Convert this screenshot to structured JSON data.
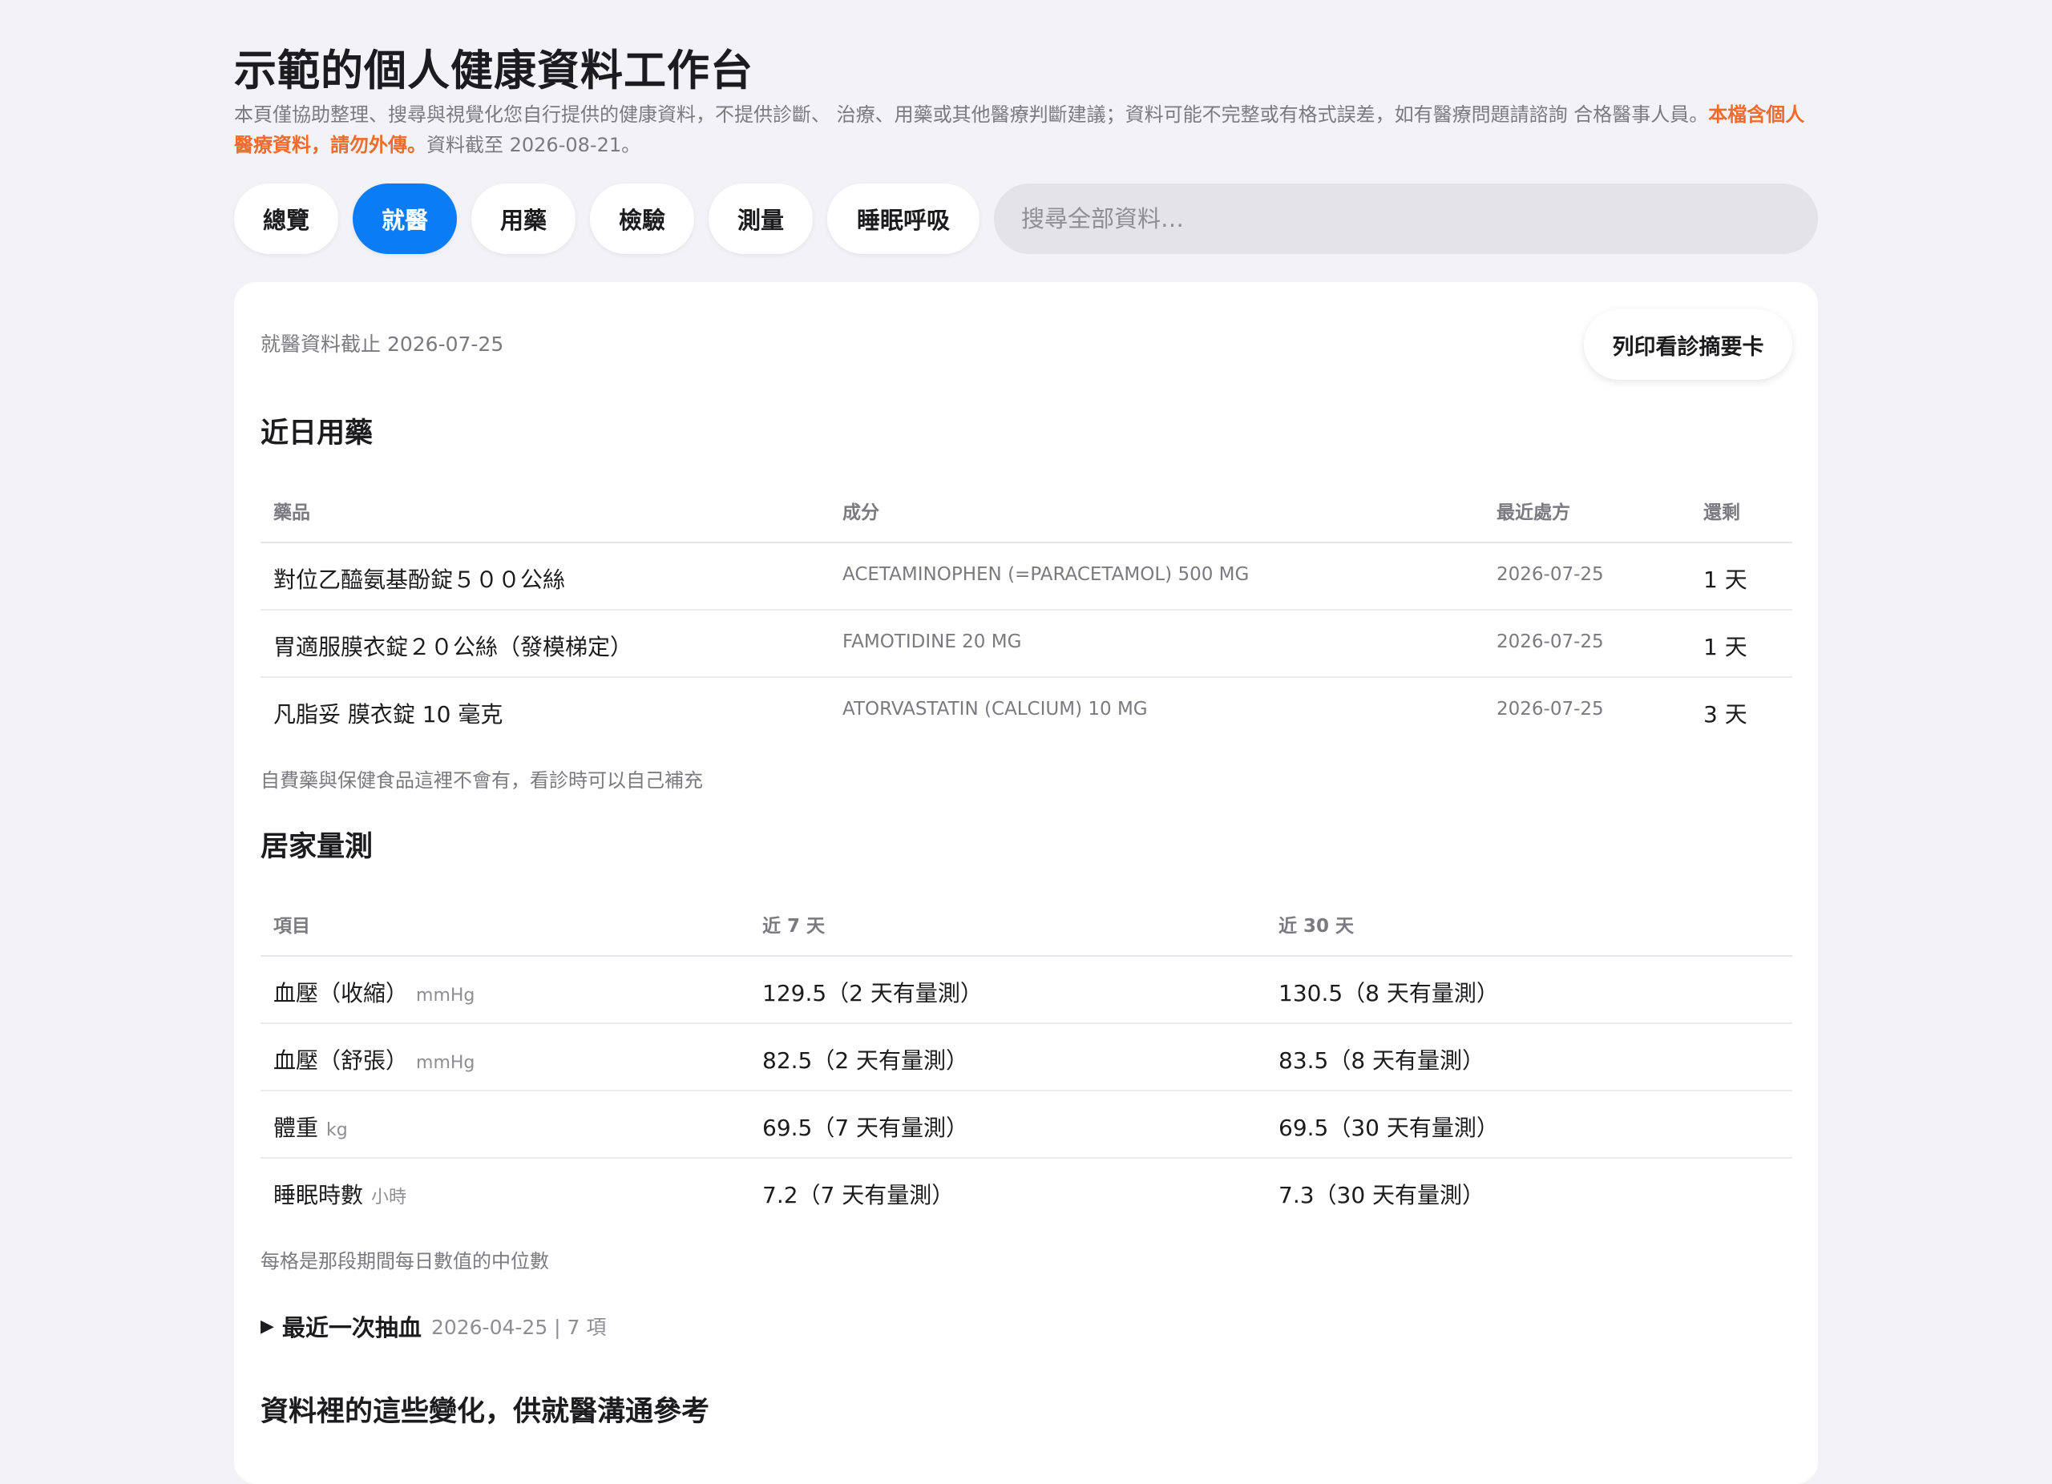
{
  "app": {
    "title": "示範的個人健康資料工作台",
    "notice_text": "本頁僅協助整理、搜尋與視覺化您自行提供的健康資料，不提供診斷、 治療、用藥或其他醫療判斷建議；資料可能不完整或有格式誤差，如有醫療問題請諮詢 合格醫事人員。",
    "notice_warning": "本檔含個人醫療資料，請勿外傳。",
    "notice_date": "資料截至 2026-08-21。"
  },
  "tabs": [
    {
      "label": "總覽",
      "active": false
    },
    {
      "label": "就醫",
      "active": true
    },
    {
      "label": "用藥",
      "active": false
    },
    {
      "label": "檢驗",
      "active": false
    },
    {
      "label": "測量",
      "active": false
    },
    {
      "label": "睡眠呼吸",
      "active": false
    }
  ],
  "search": {
    "placeholder": "搜尋全部資料…",
    "value": ""
  },
  "visit": {
    "as_of": "就醫資料截止 2026-07-25",
    "print_label": "列印看診摘要卡"
  },
  "meds": {
    "heading": "近日用藥",
    "columns": [
      "藥品",
      "成分",
      "最近處方",
      "還剩"
    ],
    "rows": [
      {
        "name": "對位乙醯氨基酚錠５００公絲",
        "ingredient": "ACETAMINOPHEN (=PARACETAMOL) 500 MG",
        "last_rx": "2026-07-25",
        "remaining": "1 天"
      },
      {
        "name": "胃適服膜衣錠２０公絲（發模梯定）",
        "ingredient": "FAMOTIDINE 20 MG",
        "last_rx": "2026-07-25",
        "remaining": "1 天"
      },
      {
        "name": "凡脂妥 膜衣錠 10 毫克",
        "ingredient": "ATORVASTATIN (CALCIUM) 10 MG",
        "last_rx": "2026-07-25",
        "remaining": "3 天"
      }
    ],
    "note": "自費藥與保健食品這裡不會有，看診時可以自己補充"
  },
  "home": {
    "heading": "居家量測",
    "columns": [
      "項目",
      "近 7 天",
      "近 30 天"
    ],
    "rows": [
      {
        "item": "血壓（收縮）",
        "unit": "mmHg",
        "d7": "129.5（2 天有量測）",
        "d30": "130.5（8 天有量測）"
      },
      {
        "item": "血壓（舒張）",
        "unit": "mmHg",
        "d7": "82.5（2 天有量測）",
        "d30": "83.5（8 天有量測）"
      },
      {
        "item": "體重",
        "unit": "kg",
        "d7": "69.5（7 天有量測）",
        "d30": "69.5（30 天有量測）"
      },
      {
        "item": "睡眠時數",
        "unit": "小時",
        "d7": "7.2（7 天有量測）",
        "d30": "7.3（30 天有量測）"
      }
    ],
    "note": "每格是那段期間每日數值的中位數"
  },
  "blood": {
    "marker": "▶",
    "label": "最近一次抽血",
    "meta": "2026-04-25 | 7 項"
  },
  "changes": {
    "heading": "資料裡的這些變化，供就醫溝通參考"
  },
  "colors": {
    "accent": "#0a7cf6",
    "warning": "#ef6c2e",
    "background": "#f2f2f7"
  }
}
